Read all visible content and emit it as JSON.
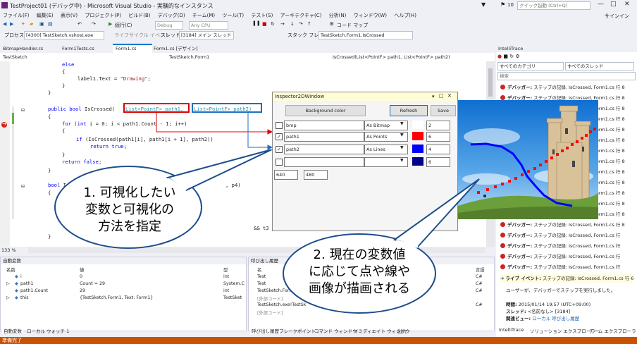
{
  "window": {
    "title": "TestProject01 (デバッグ中) - Microsoft Visual Studio - 実験的なインスタンス",
    "notification_count": "10",
    "quick_launch_placeholder": "クイック起動 (Ctrl+Q)",
    "signin": "サインイン"
  },
  "menu": [
    "ファイル(F)",
    "編集(E)",
    "表示(V)",
    "プロジェクト(P)",
    "ビルド(B)",
    "デバッグ(D)",
    "チーム(M)",
    "ツール(T)",
    "テスト(S)",
    "アーキテクチャ(C)",
    "分析(N)",
    "ウィンドウ(W)",
    "ヘルプ(H)"
  ],
  "toolbar": {
    "continue": "続行(C)",
    "config": "Debug",
    "platform": "Any CPU",
    "codemap": "コード マップ"
  },
  "debug_location": {
    "process_label": "プロセス:",
    "process_value": "[4300] TestSketch.vshost.exe",
    "lifecycle": "ライフサイクル イベント",
    "thread_label": "スレッド:",
    "thread_value": "[3184] メイン スレッド",
    "stack_label": "スタック フレーム",
    "stack_value": "TestSketch.Form1.IsCrossed"
  },
  "doc_tabs": [
    "BitmapHandler.cs",
    "Form1Tests.cs",
    "Form1.cs",
    "Form1.cs [デザイン]"
  ],
  "navbar": {
    "project": "TestSketch",
    "class": "TestSketch.Form1",
    "member": "IsCrossed(List<PointF> path1, List<PointF> path2)"
  },
  "code": {
    "l1": "else",
    "l2": "{",
    "l3a": "label1.Text = ",
    "l3b": "\"Drawing\"",
    "l3c": ";",
    "l4": "}",
    "l5": "}",
    "l6a": "public bool",
    "l6b": " IsCrossed(",
    "l6c": "List<PointF> path1,",
    "l6d": "List<PointF> path2)",
    "l7": "{",
    "l8a": "for",
    "l8b": " (",
    "l8c": "int",
    "l8d": " i = 0; i < path1.Count - 1; i++)",
    "l9": "{",
    "l10a": "if",
    "l10b": " (IsCrossed(path1[i], path1[i + 1], path2))",
    "l11a": "return true",
    "l11b": ";",
    "l12": "}",
    "l13a": "return false",
    "l13b": ";",
    "l14": "}",
    "l15a": "bool",
    "l15b": " IsCrossed(",
    "l15c": ", p4)",
    "l16": "{",
    "l17": "&& t3",
    "l18": "}",
    "zoom": "133 %"
  },
  "locals": {
    "title": "自動変数",
    "headers": [
      "名前",
      "値",
      "型"
    ],
    "rows": [
      {
        "name": "i",
        "value": "0",
        "type": "int"
      },
      {
        "name": "path1",
        "value": "Count = 29",
        "type": "System.C"
      },
      {
        "name": "path1.Count",
        "value": "29",
        "type": "int"
      },
      {
        "name": "this",
        "value": "{TestSketch.Form1, Text: Form1}",
        "type": "TestSket"
      }
    ],
    "tabs": [
      "自動変数",
      "ローカル",
      "ウォッチ 1"
    ]
  },
  "callstack": {
    "title": "呼び出し履歴",
    "headers": [
      "名",
      "言語"
    ],
    "rows": [
      "Test",
      "Test",
      "TestSketch.Form1",
      "[外部コード]",
      "TestSketch.exe!TestSk",
      "[外部コード]"
    ],
    "langs": [
      "C#",
      "C#",
      "C#",
      "C#"
    ],
    "tabs": [
      "呼び出し履歴",
      "ブレークポイント",
      "コマンド ウィンドウ",
      "イミディエイト ウィンドウ",
      "出力"
    ]
  },
  "intellitrace": {
    "title": "IntelliTrace",
    "category": "すべてのカテゴリ",
    "thread": "すべてのスレッド",
    "search": "検索",
    "event_prefix": "デバッガー:",
    "event_text": "ステップの記録: IsCrossed, Form1.cs 行 8",
    "event_text_b": "ステップの記録: IsCrossed, Form1.cs 行",
    "live_title": "ライブ イベント:",
    "live_text": "ステップの記録: IsCrossed, Form1.cs 行 6",
    "detail": "ユーザーが、デバッガーでステップを実行しました。",
    "time_label": "時間:",
    "time_value": "2015/01/14 19:57 (UTC+09:00)",
    "thread_label": "スレッド:",
    "thread_value": "<名前なし> [3184]",
    "related_label": "関連ビュー:",
    "related_local": "ローカル",
    "related_callstack": "呼び出し履歴",
    "tabs": [
      "IntelliTrace",
      "ソリューション エクスプローラー",
      "チーム エクスプローラー"
    ]
  },
  "inspector": {
    "title": "Inspector2DWindow",
    "bg_button": "Background color",
    "refresh_button": "Refresh",
    "save_button": "Save",
    "rows": [
      {
        "checked": false,
        "name": "bmp",
        "mode": "As Bitmap",
        "color": "#ffffff",
        "size": "2"
      },
      {
        "checked": true,
        "name": "path1",
        "mode": "As Points",
        "color": "#ff0000",
        "size": "6"
      },
      {
        "checked": true,
        "name": "path2",
        "mode": "As Lines",
        "color": "#0000ff",
        "size": "4"
      },
      {
        "checked": false,
        "name": "",
        "mode": "",
        "color": "#00008b",
        "size": "6"
      }
    ],
    "width": "640",
    "height": "480"
  },
  "callouts": {
    "one": [
      "1. 可視化したい",
      "変数と可視化の",
      "方法を指定"
    ],
    "two": [
      "2. 現在の変数値",
      "に応じて点や線や",
      "画像が描画される"
    ]
  },
  "status": "準備完了"
}
